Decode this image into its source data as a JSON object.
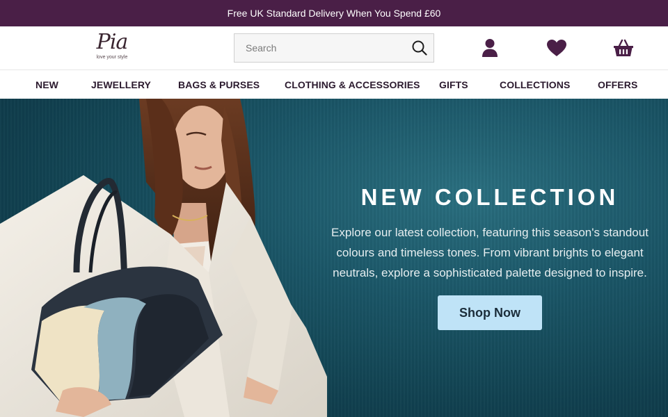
{
  "promo": {
    "text": "Free UK Standard Delivery When You Spend £60"
  },
  "logo": {
    "mark": "Pia",
    "tagline": "love your style"
  },
  "search": {
    "placeholder": "Search"
  },
  "header_icons": [
    "account-icon",
    "heart-icon",
    "basket-icon"
  ],
  "nav": {
    "items": [
      {
        "label": "NEW"
      },
      {
        "label": "JEWELLERY"
      },
      {
        "label": "BAGS & PURSES"
      },
      {
        "label": "CLOTHING & ACCESSORIES"
      },
      {
        "label": "GIFTS"
      },
      {
        "label": "COLLECTIONS"
      },
      {
        "label": "OFFERS"
      }
    ]
  },
  "hero": {
    "title": "NEW COLLECTION",
    "text": "Explore our latest collection, featuring this season's standout colours and timeless tones. From vibrant brights to elegant neutrals, explore a sophisticated palette designed to inspire.",
    "button_label": "Shop Now"
  },
  "colors": {
    "brand_purple": "#4a1f47",
    "hero_teal": "#1a5566",
    "button_blue": "#bfe3f7"
  }
}
